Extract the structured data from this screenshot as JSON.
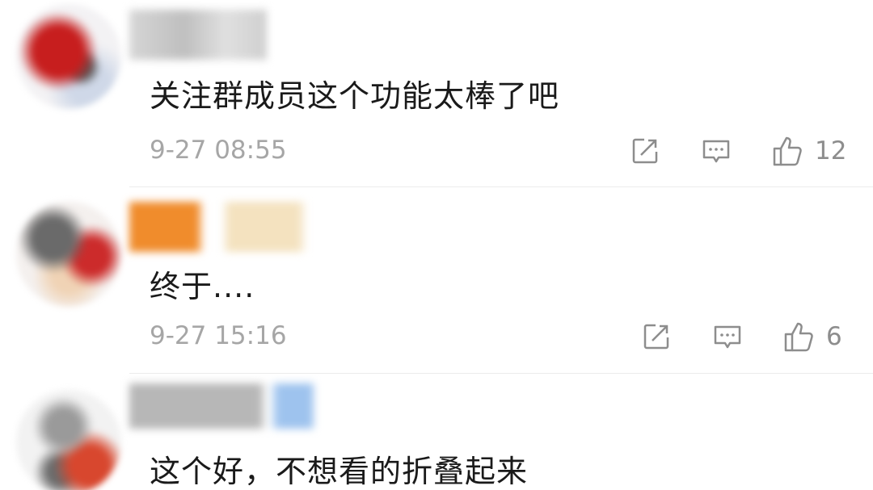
{
  "comments": [
    {
      "text": "关注群成员这个功能太棒了吧",
      "time": "9-27 08:55",
      "likes": "12"
    },
    {
      "text": "终于....",
      "time": "9-27 15:16",
      "likes": "6"
    },
    {
      "text": "这个好，不想看的折叠起来"
    }
  ],
  "icons": {
    "share": "share-icon",
    "reply": "comment-icon",
    "like": "thumbs-up-icon"
  },
  "colors": {
    "text": "#1a1a1a",
    "meta": "#a6a6a6",
    "icon": "#8d8d8d",
    "divider": "#ececec"
  }
}
